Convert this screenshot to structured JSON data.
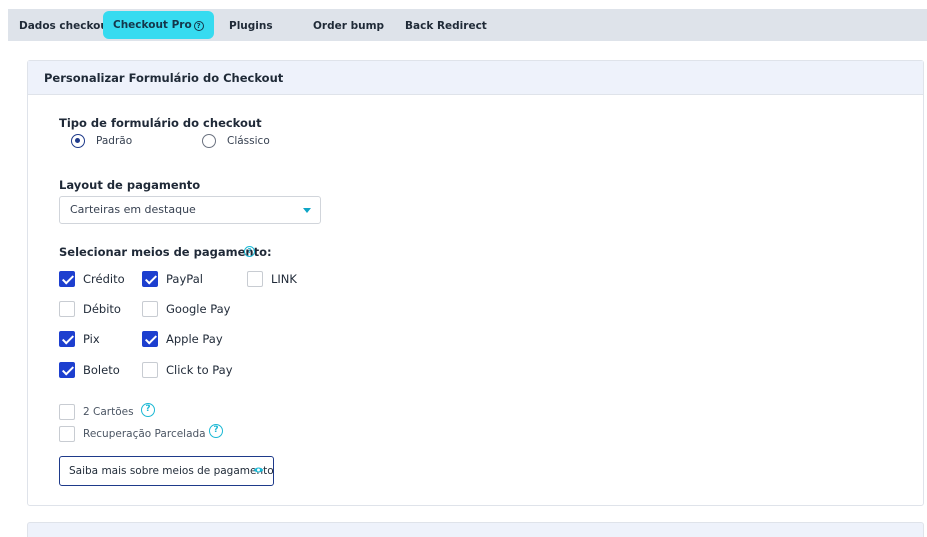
{
  "tabs": [
    {
      "label": "Dados checkout"
    },
    {
      "label": "Checkout Pro"
    },
    {
      "label": "Plugins"
    },
    {
      "label": "Order bump"
    },
    {
      "label": "Back Redirect"
    }
  ],
  "panel": {
    "title": "Personalizar Formulário do Checkout",
    "form_type": {
      "label": "Tipo de formulário do checkout",
      "options": [
        {
          "label": "Padrão",
          "selected": true
        },
        {
          "label": "Clássico",
          "selected": false
        }
      ]
    },
    "layout": {
      "label": "Layout de pagamento",
      "selected": "Carteiras em destaque"
    },
    "payment_methods": {
      "label": "Selecionar meios de pagamento:",
      "items": [
        {
          "label": "Crédito",
          "checked": true
        },
        {
          "label": "PayPal",
          "checked": true
        },
        {
          "label": "LINK",
          "checked": false
        },
        {
          "label": "Débito",
          "checked": false
        },
        {
          "label": "Google Pay",
          "checked": false
        },
        {
          "label": "Pix",
          "checked": true
        },
        {
          "label": "Apple Pay",
          "checked": true
        },
        {
          "label": "Boleto",
          "checked": true
        },
        {
          "label": "Click to Pay",
          "checked": false
        }
      ]
    },
    "extras": [
      {
        "label": "2 Cartões",
        "checked": false
      },
      {
        "label": "Recuperação Parcelada",
        "checked": false
      }
    ],
    "learn_more_button": "Saiba mais sobre meios de pagamento"
  },
  "icons": {
    "help": "?",
    "accent": "#36dbf0",
    "primary": "#1d3fcf"
  }
}
